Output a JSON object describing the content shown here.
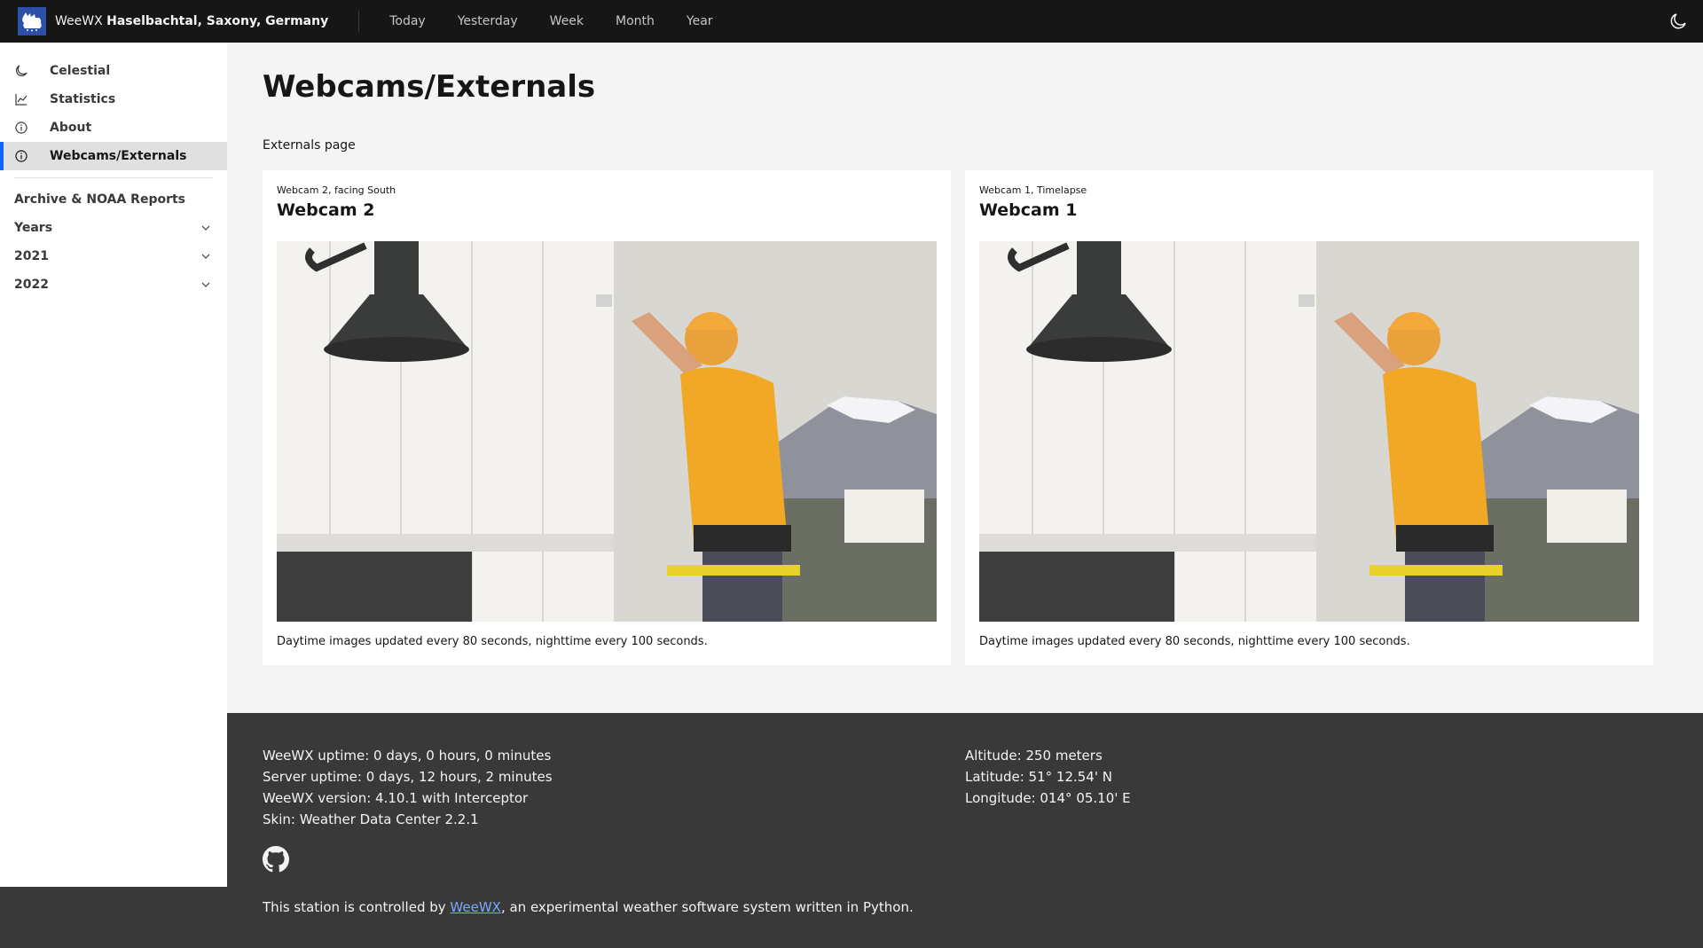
{
  "header": {
    "app_name": "WeeWX",
    "station": "Haselbachtal, Saxony, Germany",
    "nav": [
      {
        "label": "Today"
      },
      {
        "label": "Yesterday"
      },
      {
        "label": "Week"
      },
      {
        "label": "Month"
      },
      {
        "label": "Year"
      }
    ],
    "theme_icon": "moon-icon"
  },
  "sidebar": {
    "items": [
      {
        "label": "Celestial",
        "icon": "moon-icon"
      },
      {
        "label": "Statistics",
        "icon": "chart-line-icon"
      },
      {
        "label": "About",
        "icon": "info-icon"
      },
      {
        "label": "Webcams/Externals",
        "icon": "info-icon",
        "active": true
      }
    ],
    "section_title": "Archive & NOAA Reports",
    "toggles": [
      {
        "label": "Years"
      },
      {
        "label": "2021"
      },
      {
        "label": "2022"
      }
    ]
  },
  "main": {
    "title": "Webcams/Externals",
    "subtitle": "Externals page",
    "cards": [
      {
        "subtitle": "Webcam 2, facing South",
        "title": "Webcam 2",
        "caption": "Daytime images updated every 80 seconds, nighttime every 100 seconds."
      },
      {
        "subtitle": "Webcam 1, Timelapse",
        "title": "Webcam 1",
        "caption": "Daytime images updated every 80 seconds, nighttime every 100 seconds."
      }
    ]
  },
  "footer": {
    "left": [
      "WeeWX uptime: 0 days, 0 hours, 0 minutes",
      "Server uptime: 0 days, 12 hours, 2 minutes",
      "WeeWX version: 4.10.1 with Interceptor",
      "Skin: Weather Data Center 2.2.1"
    ],
    "right": [
      "Altitude: 250 meters",
      "Latitude: 51° 12.54' N",
      "Longitude: 014° 05.10' E"
    ],
    "credit_prefix": "This station is controlled by ",
    "credit_link": "WeeWX",
    "credit_suffix": ", an experimental weather software system written in Python."
  },
  "colors": {
    "accent": "#0f62fe",
    "header_bg": "#161616",
    "footer_bg": "#393939",
    "link": "#78a9ff"
  }
}
